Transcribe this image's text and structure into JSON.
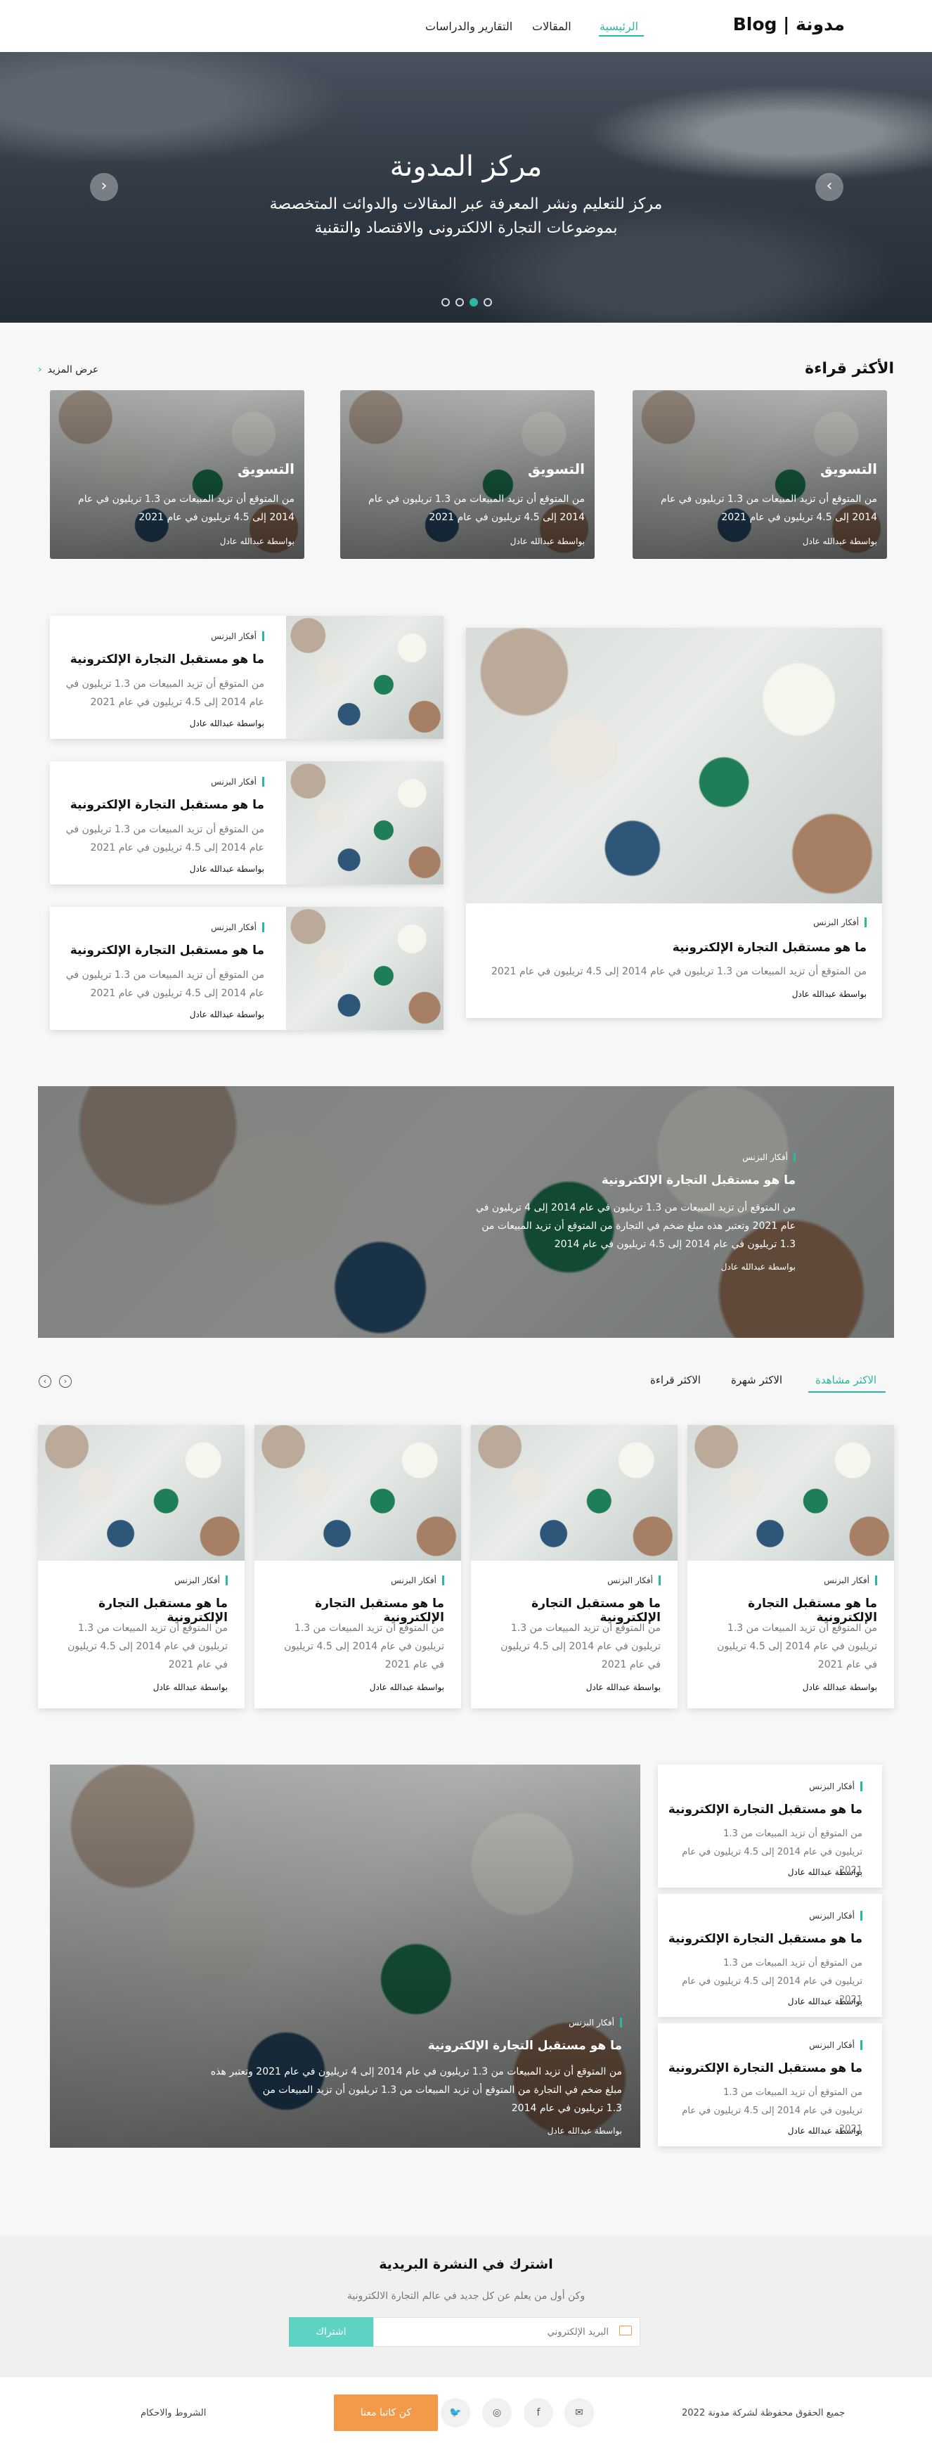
{
  "header": {
    "logo": "مدونة | Blog",
    "nav": [
      "الرئيسية",
      "المقالات",
      "التقارير والدراسات"
    ],
    "active_nav": "الرئيسية"
  },
  "hero": {
    "title": "مركز المدونة",
    "subtitle": "مركز للتعليم ونشر المعرفة عبر المقالات والدوائت المتخصصة بموضوعات التجارة الالكترونى والاقتصاد والتقنية",
    "slides": 4,
    "active_slide": 2,
    "prev_icon": "chevron-left-icon",
    "next_icon": "chevron-right-icon"
  },
  "most_read": {
    "title": "الأكثر قراءة",
    "view_more": "عرض المزيد",
    "cards": [
      {
        "category": "التسويق",
        "desc": "من المتوقع أن تزيد المبيعات من 1.3 تريليون في عام 2014 إلى 4.5 تريليون في عام 2021",
        "author": "بواسطة عبدالله عادل"
      },
      {
        "category": "التسويق",
        "desc": "من المتوقع أن تزيد المبيعات من 1.3 تريليون في عام 2014 إلى 4.5 تريليون في عام 2021",
        "author": "بواسطة عبدالله عادل"
      },
      {
        "category": "التسويق",
        "desc": "من المتوقع أن تزيد المبيعات من 1.3 تريليون في عام 2014 إلى 4.5 تريليون في عام 2021",
        "author": "بواسطة عبدالله عادل"
      }
    ]
  },
  "featured": {
    "main": {
      "tag": "أفكار البزنس",
      "title": "ما هو مستقبل التجارة الإلكترونية",
      "desc": "من المتوقع أن تزيد المبيعات من 1.3 تريليون في عام 2014 إلى 4.5 تريليون في عام 2021",
      "author": "بواسطة عبدالله عادل"
    },
    "side": [
      {
        "tag": "أفكار البزنس",
        "title": "ما هو مستقبل التجارة الإلكترونية",
        "desc1": "من المتوقع أن تزيد المبيعات من 1.3 تريليون في",
        "desc2": "عام 2014 إلى 4.5 تريليون في عام 2021",
        "author": "بواسطة عبدالله عادل"
      },
      {
        "tag": "أفكار البزنس",
        "title": "ما هو مستقبل التجارة الإلكترونية",
        "desc1": "من المتوقع أن تزيد المبيعات من 1.3 تريليون في",
        "desc2": "عام 2014 إلى 4.5 تريليون في عام 2021",
        "author": "بواسطة عبدالله عادل"
      },
      {
        "tag": "أفكار البزنس",
        "title": "ما هو مستقبل التجارة الإلكترونية",
        "desc1": "من المتوقع أن تزيد المبيعات من 1.3 تريليون في",
        "desc2": "عام 2014 إلى 4.5 تريليون في عام 2021",
        "author": "بواسطة عبدالله عادل"
      }
    ]
  },
  "banner": {
    "tag": "أفكار البزنس",
    "title": "ما هو مستقبل التجارة الإلكترونية",
    "lines": [
      "من المتوقع أن تزيد المبيعات من 1.3 تريليون في عام 2014 إلى 4 تريليون في",
      "عام 2021 وتعتبر هذه مبلغ ضخم في التجارة من المتوقع أن تزيد المبيعات من",
      "1.3 تريليون في عام 2014 إلى 4.5 تريليون في عام 2014"
    ],
    "author": "بواسطة عبدالله عادل"
  },
  "tabs": {
    "items": [
      "الاكثر مشاهدة",
      "الاكثر شهرة",
      "الاكثر قراءة"
    ],
    "active": "الاكثر مشاهدة",
    "prev_icon": "circle-left-icon",
    "next_icon": "circle-right-icon"
  },
  "grid_cards": [
    {
      "tag": "أفكار البزنس",
      "title": "ما هو مستقبل التجارة الإلكترونية",
      "desc": [
        "من المتوقع أن تزيد المبيعات من 1.3",
        "تريليون في عام 2014 إلى 4.5 تريليون",
        "في عام 2021"
      ],
      "author": "بواسطة عبدالله عادل"
    },
    {
      "tag": "أفكار البزنس",
      "title": "ما هو مستقبل التجارة الإلكترونية",
      "desc": [
        "من المتوقع أن تزيد المبيعات من 1.3",
        "تريليون في عام 2014 إلى 4.5 تريليون",
        "في عام 2021"
      ],
      "author": "بواسطة عبدالله عادل"
    },
    {
      "tag": "أفكار البزنس",
      "title": "ما هو مستقبل التجارة الإلكترونية",
      "desc": [
        "من المتوقع أن تزيد المبيعات من 1.3",
        "تريليون في عام 2014 إلى 4.5 تريليون",
        "في عام 2021"
      ],
      "author": "بواسطة عبدالله عادل"
    },
    {
      "tag": "أفكار البزنس",
      "title": "ما هو مستقبل التجارة الإلكترونية",
      "desc": [
        "من المتوقع أن تزيد المبيعات من 1.3",
        "تريليون في عام 2014 إلى 4.5 تريليون",
        "في عام 2021"
      ],
      "author": "بواسطة عبدالله عادل"
    }
  ],
  "bottom": {
    "side": [
      {
        "tag": "أفكار البزنس",
        "title": "ما هو مستقبل التجارة الإلكترونية",
        "desc1": "من المتوقع أن تزيد المبيعات من 1.3",
        "desc2": "تريليون في عام 2014 إلى 4.5 تريليون في عام 2021",
        "author": "بواسطة عبدالله عادل"
      },
      {
        "tag": "أفكار البزنس",
        "title": "ما هو مستقبل التجارة الإلكترونية",
        "desc1": "من المتوقع أن تزيد المبيعات من 1.3",
        "desc2": "تريليون في عام 2014 إلى 4.5 تريليون في عام 2021",
        "author": "بواسطة عبدالله عادل"
      },
      {
        "tag": "أفكار البزنس",
        "title": "ما هو مستقبل التجارة الإلكترونية",
        "desc1": "من المتوقع أن تزيد المبيعات من 1.3",
        "desc2": "تريليون في عام 2014 إلى 4.5 تريليون في عام 2021",
        "author": "بواسطة عبدالله عادل"
      }
    ],
    "big": {
      "tag": "أفكار البزنس",
      "title": "ما هو مستقبل التجارة الإلكترونية",
      "lines": [
        "من المتوقع أن تزيد المبيعات من 1.3 تريليون في عام 2014 إلى 4 تريليون في عام 2021 وتعتبر هذه",
        "مبلغ ضخم في التجارة من المتوقع أن تزيد المبيعات من 1.3 تريليون أن تزيد المبيعات من",
        "1.3 تريليون في عام 2014"
      ],
      "author": "بواسطة عبدالله عادل"
    }
  },
  "newsletter": {
    "title": "اشترك في النشرة البريدية",
    "subtitle": "وكن أول من يعلم عن كل جديد في عالم التجارة الالكترونية",
    "placeholder": "البريد الإلكتروني",
    "button": "اشتراك",
    "mail_icon": "mail-icon"
  },
  "footer": {
    "copyright": "جميع الحقوق محفوظة لشركة مدونة 2022",
    "social_icons": [
      "mail-icon",
      "facebook-icon",
      "instagram-icon",
      "twitter-icon"
    ],
    "social_glyphs": [
      "✉",
      "f",
      "◎",
      "🐦"
    ],
    "cta": "كن كاتبا معنا",
    "terms": "الشروط والاحكام"
  },
  "colors": {
    "accent": "#2bb7a3",
    "orange": "#f2994a",
    "button_teal": "#5fd3c3"
  }
}
